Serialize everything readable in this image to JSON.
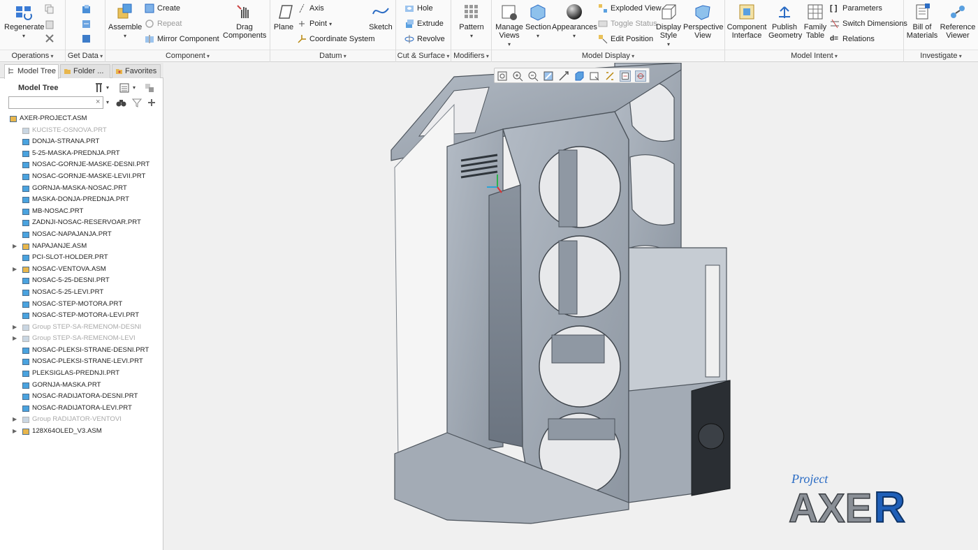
{
  "ribbon": {
    "operations": {
      "label": "Operations",
      "regenerate": "Regenerate"
    },
    "get_data": {
      "label": "Get Data"
    },
    "component": {
      "label": "Component",
      "assemble": "Assemble",
      "create": "Create",
      "repeat": "Repeat",
      "mirror": "Mirror Component",
      "drag": "Drag Components"
    },
    "datum": {
      "label": "Datum",
      "plane": "Plane",
      "axis": "Axis",
      "point": "Point",
      "coord": "Coordinate System",
      "sketch": "Sketch"
    },
    "cut_surface": {
      "label": "Cut & Surface",
      "hole": "Hole",
      "extrude": "Extrude",
      "revolve": "Revolve"
    },
    "modifiers": {
      "label": "Modifiers",
      "pattern": "Pattern"
    },
    "model_display": {
      "label": "Model Display",
      "manage_views": "Manage Views",
      "section": "Section",
      "appearances": "Appearances",
      "exploded": "Exploded View",
      "toggle": "Toggle Status",
      "edit_position": "Edit Position",
      "display_style": "Display Style",
      "perspective": "Perspective View"
    },
    "model_intent": {
      "label": "Model Intent",
      "component_interface": "Component Interface",
      "publish_geometry": "Publish Geometry",
      "family_table": "Family Table",
      "parameters": "Parameters",
      "switch_dimensions": "Switch Dimensions",
      "relations": "Relations"
    },
    "investigate": {
      "label": "Investigate",
      "bom": "Bill of Materials",
      "ref_viewer": "Reference Viewer"
    }
  },
  "panel": {
    "tabs": [
      "Model Tree",
      "Folder ...",
      "Favorites"
    ],
    "title": "Model Tree",
    "search_value": ""
  },
  "tree": [
    {
      "label": "AXER-PROJECT.ASM",
      "kind": "asm",
      "level": 0,
      "expand": false,
      "grey": false
    },
    {
      "label": "KUCISTE-OSNOVA.PRT",
      "kind": "prt",
      "level": 1,
      "expand": false,
      "grey": true
    },
    {
      "label": "DONJA-STRANA.PRT",
      "kind": "prt",
      "level": 1,
      "expand": false,
      "grey": false
    },
    {
      "label": "5-25-MASKA-PREDNJA.PRT",
      "kind": "prt",
      "level": 1,
      "expand": false,
      "grey": false
    },
    {
      "label": "NOSAC-GORNJE-MASKE-DESNI.PRT",
      "kind": "prt",
      "level": 1,
      "expand": false,
      "grey": false
    },
    {
      "label": "NOSAC-GORNJE-MASKE-LEVII.PRT",
      "kind": "prt",
      "level": 1,
      "expand": false,
      "grey": false
    },
    {
      "label": "GORNJA-MASKA-NOSAC.PRT",
      "kind": "prt",
      "level": 1,
      "expand": false,
      "grey": false
    },
    {
      "label": "MASKA-DONJA-PREDNJA.PRT",
      "kind": "prt",
      "level": 1,
      "expand": false,
      "grey": false
    },
    {
      "label": "MB-NOSAC.PRT",
      "kind": "prt",
      "level": 1,
      "expand": false,
      "grey": false
    },
    {
      "label": "ZADNJI-NOSAC-RESERVOAR.PRT",
      "kind": "prt",
      "level": 1,
      "expand": false,
      "grey": false
    },
    {
      "label": "NOSAC-NAPAJANJA.PRT",
      "kind": "prt",
      "level": 1,
      "expand": false,
      "grey": false
    },
    {
      "label": "NAPAJANJE.ASM",
      "kind": "asm",
      "level": 1,
      "expand": true,
      "grey": false
    },
    {
      "label": "PCI-SLOT-HOLDER.PRT",
      "kind": "prt",
      "level": 1,
      "expand": false,
      "grey": false
    },
    {
      "label": "NOSAC-VENTOVA.ASM",
      "kind": "asm",
      "level": 1,
      "expand": true,
      "grey": false
    },
    {
      "label": "NOSAC-5-25-DESNI.PRT",
      "kind": "prt",
      "level": 1,
      "expand": false,
      "grey": false
    },
    {
      "label": "NOSAC-5-25-LEVI.PRT",
      "kind": "prt",
      "level": 1,
      "expand": false,
      "grey": false
    },
    {
      "label": "NOSAC-STEP-MOTORA.PRT",
      "kind": "prt",
      "level": 1,
      "expand": false,
      "grey": false
    },
    {
      "label": "NOSAC-STEP-MOTORA-LEVI.PRT",
      "kind": "prt",
      "level": 1,
      "expand": false,
      "grey": false
    },
    {
      "label": "Group STEP-SA-REMENOM-DESNI",
      "kind": "grp",
      "level": 1,
      "expand": true,
      "grey": true
    },
    {
      "label": "Group STEP-SA-REMENOM-LEVI",
      "kind": "grp",
      "level": 1,
      "expand": true,
      "grey": true
    },
    {
      "label": "NOSAC-PLEKSI-STRANE-DESNI.PRT",
      "kind": "prt",
      "level": 1,
      "expand": false,
      "grey": false
    },
    {
      "label": "NOSAC-PLEKSI-STRANE-LEVI.PRT",
      "kind": "prt",
      "level": 1,
      "expand": false,
      "grey": false
    },
    {
      "label": "PLEKSIGLAS-PREDNJI.PRT",
      "kind": "prt",
      "level": 1,
      "expand": false,
      "grey": false
    },
    {
      "label": "GORNJA-MASKA.PRT",
      "kind": "prt",
      "level": 1,
      "expand": false,
      "grey": false
    },
    {
      "label": "NOSAC-RADIJATORA-DESNI.PRT",
      "kind": "prt",
      "level": 1,
      "expand": false,
      "grey": false
    },
    {
      "label": "NOSAC-RADIJATORA-LEVI.PRT",
      "kind": "prt",
      "level": 1,
      "expand": false,
      "grey": false
    },
    {
      "label": "Group RADIJATOR-VENTOVI",
      "kind": "grp",
      "level": 1,
      "expand": true,
      "grey": true
    },
    {
      "label": "128X64OLED_V3.ASM",
      "kind": "asm",
      "level": 1,
      "expand": true,
      "grey": false
    }
  ],
  "logo": {
    "small": "Project",
    "big": "AXE",
    "accent": "R"
  },
  "colors": {
    "accent": "#2b6cc4",
    "model": "#9aa2ad",
    "model_dark": "#6e7782",
    "folder": "#e8b64c",
    "part": "#4aa3df"
  }
}
